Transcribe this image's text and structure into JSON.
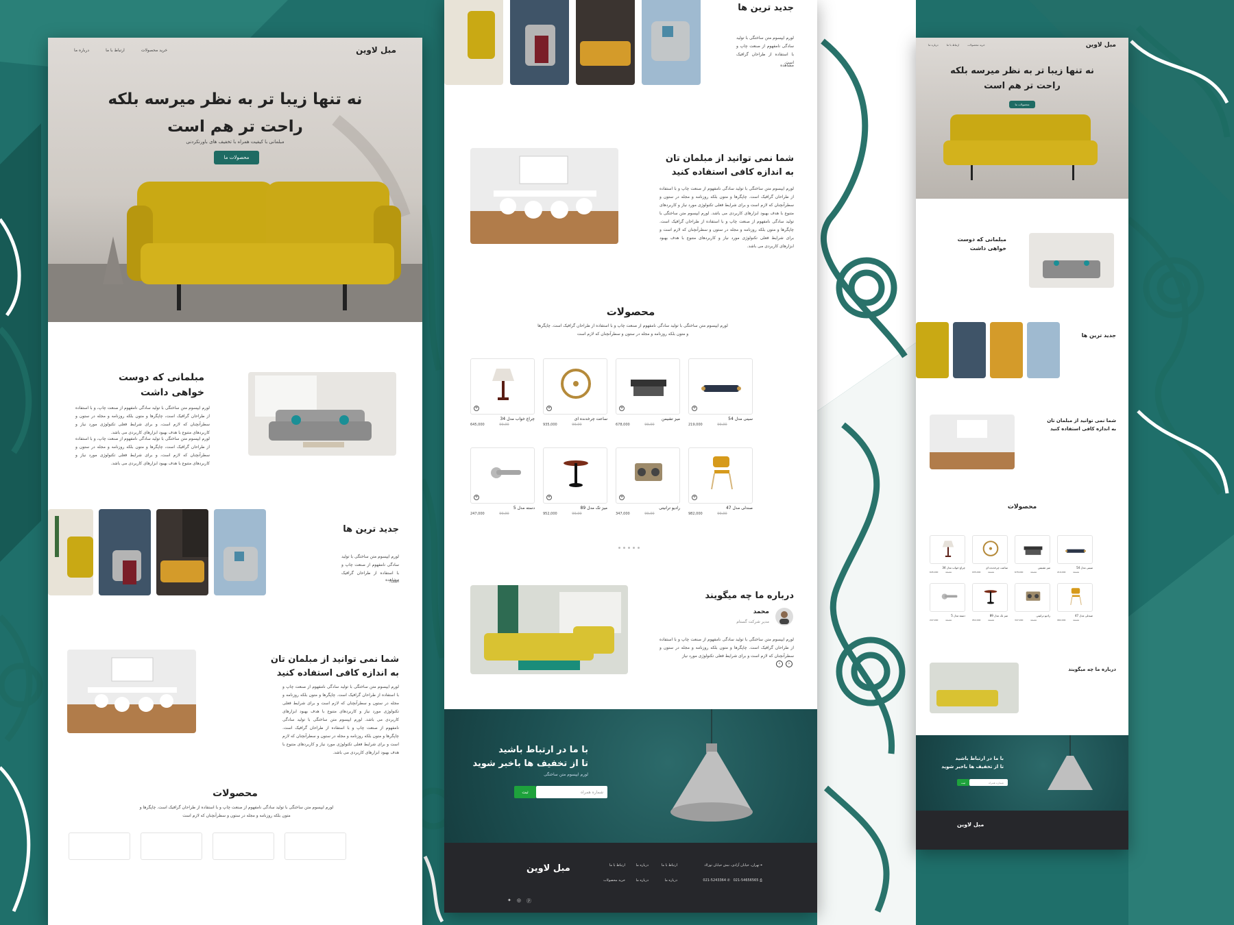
{
  "site": {
    "brand": "مبل لاوین",
    "nav": [
      "خرید محصولات",
      "ارتباط با ما",
      "درباره ما"
    ]
  },
  "hero": {
    "title_line1": "نه تنها زیبا تر به نظر میرسه بلکه",
    "title_line2": "راحت تر هم است",
    "subtitle": "مبلمانی با کیفیت همراه با تخفیف های باورنکردنی",
    "button": "محصولات ما"
  },
  "about": {
    "title_line1": "مبلمانی که دوست",
    "title_line2": "خواهی داشت",
    "p1": "لورم ایپسوم متن ساختگی با تولید سادگی نامفهوم از صنعت چاپ، و با استفاده از طراحان گرافیک است، چاپگرها و متون بلکه روزنامه و مجله در ستون و سطرآنچنان که لازم است، و برای شرایط فعلی تکنولوژی مورد نیاز و کاربردهای متنوع با هدف بهبود ابزارهای کاربردی می باشد.",
    "p2": "لورم ایپسوم متن ساختگی با تولید سادگی نامفهوم از صنعت چاپ، و با استفاده از طراحان گرافیک است، چاپگرها و متون بلکه روزنامه و مجله در ستون و سطرآنچنان که لازم است، و برای شرایط فعلی تکنولوژی مورد نیاز و کاربردهای متنوع با هدف بهبود ابزارهای کاربردی می باشد."
  },
  "newest": {
    "title": "جدید ترین ها",
    "text": "لورم ایپسوم متن ساختگی با تولید سادگی نامفهوم از صنعت چاپ و با استفاده از طراحان گرافیک است.",
    "link": "مشاهده"
  },
  "fit": {
    "title_line1": "شما نمی توانید از مبلمان تان",
    "title_line2": "به اندازه کافی استفاده کنید",
    "p": "لورم ایپسوم متن ساختگی با تولید سادگی نامفهوم از صنعت چاپ و با استفاده از طراحان گرافیک است. چاپگرها و متون بلکه روزنامه و مجله در ستون و سطرآنچنان که لازم است و برای شرایط فعلی تکنولوژی مورد نیاز و کاربردهای متنوع با هدف بهبود ابزارهای کاربردی می باشد. لورم ایپسوم متن ساختگی با تولید سادگی نامفهوم از صنعت چاپ و با استفاده از طراحان گرافیک است. چاپگرها و متون بلکه روزنامه و مجله در ستون و سطرآنچنان که لازم است و برای شرایط فعلی تکنولوژی مورد نیاز و کاربردهای متنوع با هدف بهبود ابزارهای کاربردی می باشد."
  },
  "products": {
    "title": "محصولات",
    "intro": "لورم ایپسوم متن ساختگی با تولید سادگی نامفهوم از صنعت چاپ و با استفاده از طراحان گرافیک است. چاپگرها و متون بلکه روزنامه و مجله در ستون و سطرآنچنان که لازم است",
    "items": [
      {
        "name": "سینی مدل 54",
        "price": "219,000",
        "old": "99,00",
        "icon": "tray-icon"
      },
      {
        "name": "میز تشیمن",
        "price": "678,000",
        "old": "99,00",
        "icon": "coffee-table-icon"
      },
      {
        "name": "ساعت چرخدنده ای",
        "price": "935,000",
        "old": "99,00",
        "icon": "gear-clock-icon"
      },
      {
        "name": "چراغ خواب مدل 34",
        "price": "645,000",
        "old": "99,00",
        "icon": "lamp-icon"
      },
      {
        "name": "صندلی مدل 47",
        "price": "982,000",
        "old": "99,00",
        "icon": "chair-icon"
      },
      {
        "name": "رادیو ترانیتی",
        "price": "347,000",
        "old": "99,00",
        "icon": "radio-icon"
      },
      {
        "name": "میز تک مدل 89",
        "price": "952,000",
        "old": "99,00",
        "icon": "side-table-icon"
      },
      {
        "name": "دسته مدل 5",
        "price": "247,000",
        "old": "99,00",
        "icon": "door-handle-icon"
      }
    ]
  },
  "testimonial": {
    "title": "درباره ما چه میگویند",
    "name": "محمد",
    "role": "مدیر شرکت گستام",
    "text": "لورم ایپسوم متن ساختگی با تولید سادگی نامفهوم از صنعت چاپ و با استفاده از طراحان گرافیک است. چاپگرها و متون بلکه روزنامه و مجله در ستون و سطرآنچنان که لازم است و برای شرایط فعلی تکنولوژی مورد نیاز"
  },
  "newsletter": {
    "title_line1": "با ما در ارتباط باشید",
    "title_line2": "تا از تخفیف ها باخبر شوید",
    "sub": "لورم ایپسوم متن ساختگی",
    "placeholder": "شماره همراه",
    "button": "ثبت"
  },
  "footer": {
    "brand": "مبل لاوین",
    "address": "تهران، خیابان آزادی، نبش خیابان توزلاد",
    "phone1": "021-5243364",
    "phone2": "021-54656565",
    "links_col1": [
      "ارتباط با ما",
      "خرید محصولات"
    ],
    "links_col2": [
      "درباره ما",
      "درباره ما"
    ],
    "links_col3": [
      "ارتباط با ما",
      "درباره ما"
    ]
  },
  "colors": {
    "accent": "#1e6b63",
    "background": "#1f6f6a",
    "sofa": "#c9a914",
    "footer": "#26272b",
    "submit": "#1ea23c"
  }
}
